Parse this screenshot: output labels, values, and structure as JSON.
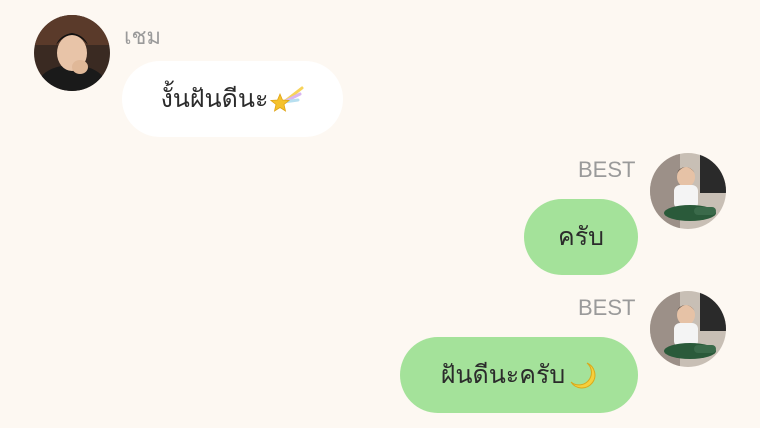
{
  "messages": [
    {
      "direction": "incoming",
      "sender": "เชม",
      "text": "งั้นฝันดีนะ",
      "emoji": "shooting-star-icon"
    },
    {
      "direction": "outgoing",
      "sender": "BEST",
      "text": "ครับ"
    },
    {
      "direction": "outgoing",
      "sender": "BEST",
      "text": "ฝันดีนะครับ",
      "emoji": "crescent-moon-icon"
    }
  ],
  "colors": {
    "background": "#fdf8f2",
    "incoming_bubble": "#ffffff",
    "outgoing_bubble": "#a4e29a",
    "sender_name": "#9a9a9a"
  }
}
